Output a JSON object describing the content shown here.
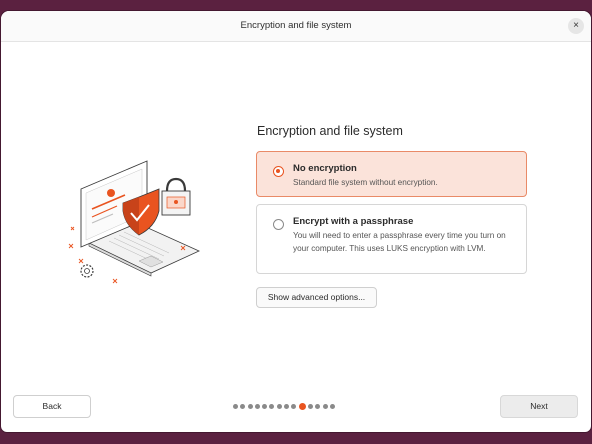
{
  "window": {
    "title": "Encryption and file system",
    "close_glyph": "×"
  },
  "main": {
    "heading": "Encryption and file system",
    "options": [
      {
        "title": "No encryption",
        "description": "Standard file system without encryption.",
        "selected": true
      },
      {
        "title": "Encrypt with a passphrase",
        "description": "You will need to enter a passphrase every time you turn on your computer. This uses LUKS encryption with LVM.",
        "selected": false
      }
    ],
    "advanced_button": "Show advanced options..."
  },
  "footer": {
    "back_label": "Back",
    "next_label": "Next",
    "progress": {
      "total_steps": 14,
      "current_step": 10
    }
  },
  "illustration": {
    "icon": "laptop-lock-shield-illustration"
  },
  "colors": {
    "accent": "#e95420",
    "selected_bg": "#fbe3da",
    "desktop": "#5b2140"
  }
}
